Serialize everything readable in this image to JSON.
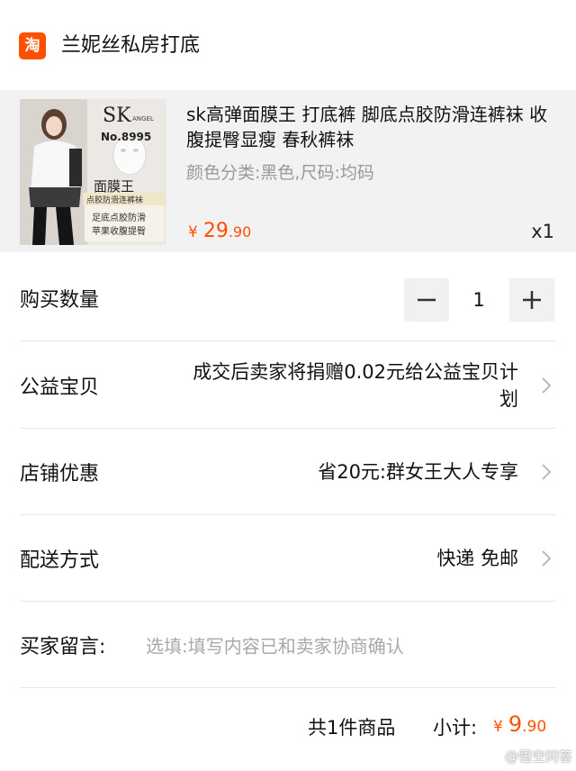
{
  "shop": {
    "icon_glyph": "淘",
    "name": "兰妮丝私房打底"
  },
  "product": {
    "title": "sk高弹面膜王 打底裤  脚底点胶防滑连裤袜 收腹提臀显瘦 春秋裤袜",
    "sku": "颜色分类:黑色,尺码:均码",
    "price_symbol": "¥",
    "price_int": "29",
    "price_dec": ".90",
    "qty": "x1",
    "image_text": {
      "brand": "SK",
      "brand_sub": "ANGEL",
      "model": "No.8995",
      "name": "面膜王",
      "tag": "点胶防滑连裤袜",
      "line1": "足底点胶防滑",
      "line2": "苹果收腹提臀"
    }
  },
  "quantity": {
    "label": "购买数量",
    "value": "1",
    "minus": "−",
    "plus": "+"
  },
  "charity": {
    "label": "公益宝贝",
    "value_line1": "成交后卖家将捐赠0.02元给公益宝贝计",
    "value_line2": "划"
  },
  "discount": {
    "label": "店铺优惠",
    "value": "省20元:群女王大人专享"
  },
  "delivery": {
    "label": "配送方式",
    "value": "快递 免邮"
  },
  "message": {
    "label": "买家留言:",
    "placeholder": "选填:填写内容已和卖家协商确认"
  },
  "summary": {
    "count": "共1件商品",
    "subtotal_label": "小计:",
    "price_symbol": "¥",
    "price_int": "9",
    "price_dec": ".90"
  },
  "watermark": "@悟空问答",
  "colors": {
    "accent": "#ff5000",
    "muted": "#999999",
    "product_bg": "#f2f2f2"
  }
}
